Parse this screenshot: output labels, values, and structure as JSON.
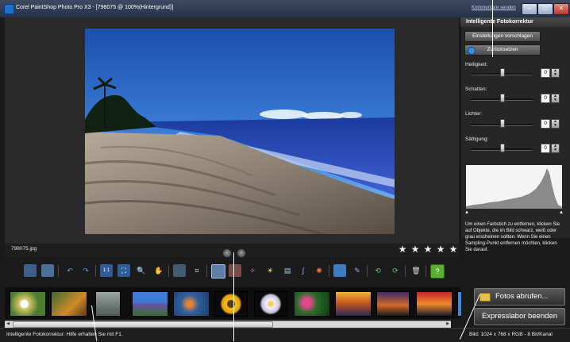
{
  "window": {
    "title": "Corel PaintShop Photo Pro X3 - [798075 @ 100%(Hintergrund)]",
    "comment_link": "Kommentare senden",
    "min_glyph": "–",
    "max_glyph": "□",
    "close_glyph": "✕"
  },
  "panel": {
    "title": "Intelligente Fotokorrektur",
    "suggest_button": "Einstellungen vorschlagen",
    "reset_button": "Zurücksetzen",
    "sliders": [
      {
        "label": "Helligkeit:",
        "value": "0",
        "level": 0.5
      },
      {
        "label": "Schatten:",
        "value": "0",
        "level": 0.5
      },
      {
        "label": "Lichter:",
        "value": "0",
        "level": 0.5
      },
      {
        "label": "Sättigung:",
        "value": "0",
        "level": 0.5
      }
    ],
    "spin_up": "▲",
    "spin_down": "▼",
    "help_text": "Um einen Farbstich zu entfernen, klicken Sie auf Objekte, die im Bild schwarz, weiß oder grau erscheinen sollten. Wenn Sie einen Sampling-Punkt entfernen möchten, klicken Sie darauf.",
    "histogram_black_marker": "▲",
    "histogram_white_marker": "▲"
  },
  "image_info": {
    "filename": "798075.jpg",
    "nav_prev": "‹",
    "nav_next": "›",
    "rating_stars": 5,
    "star_glyph": "★"
  },
  "toolbar": {
    "icons": [
      "save-icon",
      "save-as-icon",
      "undo-icon",
      "redo-icon",
      "actual-size-icon",
      "fit-window-icon",
      "zoom-icon",
      "pan-hand-icon",
      "straighten-icon",
      "crop-icon",
      "smart-fix-icon",
      "red-eye-icon",
      "makeover-icon",
      "fill-light-icon",
      "levels-icon",
      "curves-icon",
      "retouch-icon",
      "3d-cube-icon",
      "clone-icon",
      "rotate-left-icon",
      "rotate-right-icon",
      "delete-icon",
      "help-icon"
    ],
    "help_glyph": "?"
  },
  "filmstrip": {
    "thumbnails": [
      "daisies",
      "river-autumn",
      "rock-stone",
      "lavender-field",
      "starfish",
      "sunflower",
      "white-flower",
      "pink-orchids",
      "sunset-field",
      "evening-street",
      "red-sunset",
      "blue-sky"
    ]
  },
  "actions": {
    "fetch_button": "Fotos abrufen...",
    "exit_button": "Expresslabor beenden"
  },
  "scrollbar": {
    "left_arrow": "◀",
    "right_arrow": "▶"
  },
  "status": {
    "left": "Intelligente Fotokorrektur: Hilfe erhalten Sie mit F1.",
    "right": "Bild: 1024 x 768 x RGB - 8 Bit/Kanal"
  },
  "colors": {
    "accent": "#1e6fd0",
    "panel_bg": "#262626",
    "workspace_bg": "#2a2a2a"
  }
}
